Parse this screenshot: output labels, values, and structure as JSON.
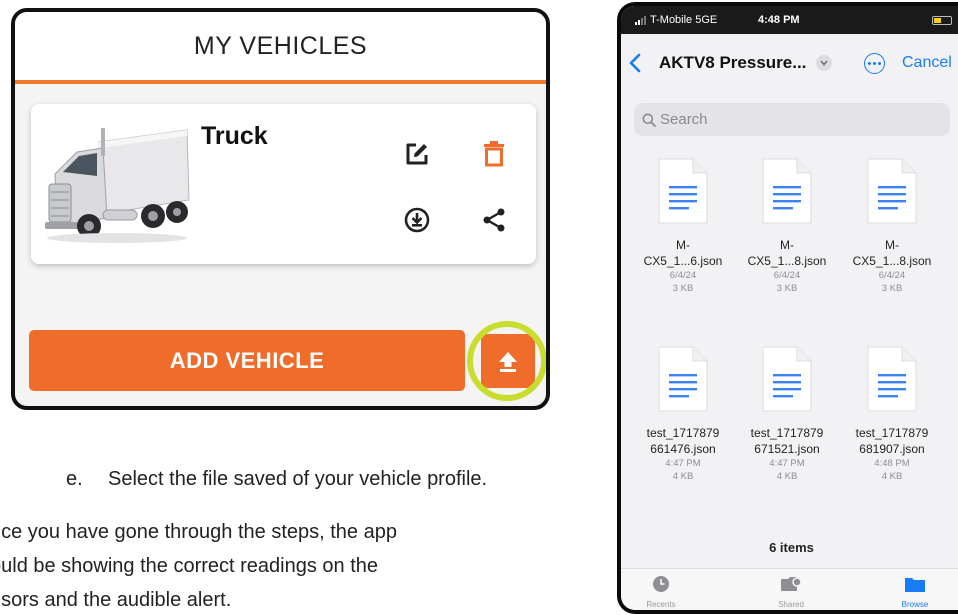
{
  "app": {
    "title": "MY VEHICLES",
    "vehicle": {
      "name": "Truck"
    },
    "add_vehicle_label": "ADD VEHICLE",
    "icons": [
      "edit-icon",
      "delete-icon",
      "download-icon",
      "share-icon",
      "upload-icon"
    ],
    "colors": {
      "accent": "#ef6c2a",
      "highlight": "#c9dd2f"
    }
  },
  "instructions": {
    "step_marker": "e.",
    "step_text": "Select the file saved of your vehicle profile.",
    "lines": [
      "nce you have gone through the steps, the app",
      "ould be showing the correct readings on the",
      "nsors and the audible alert."
    ]
  },
  "phone": {
    "status": {
      "carrier": "T-Mobile 5GE",
      "time": "4:48 PM"
    },
    "nav": {
      "title": "AKTV8  Pressure...",
      "cancel": "Cancel"
    },
    "search": {
      "placeholder": "Search"
    },
    "files": [
      {
        "name_line1": "M-",
        "name_line2": "CX5_1...6.json",
        "date": "6/4/24",
        "size": "3 KB"
      },
      {
        "name_line1": "M-",
        "name_line2": "CX5_1...8.json",
        "date": "6/4/24",
        "size": "3 KB"
      },
      {
        "name_line1": "M-",
        "name_line2": "CX5_1...8.json",
        "date": "6/4/24",
        "size": "3 KB"
      },
      {
        "name_line1": "test_1717879",
        "name_line2": "661476.json",
        "date": "4:47 PM",
        "size": "4 KB"
      },
      {
        "name_line1": "test_1717879",
        "name_line2": "671521.json",
        "date": "4:47 PM",
        "size": "4 KB"
      },
      {
        "name_line1": "test_1717879",
        "name_line2": "681907.json",
        "date": "4:48 PM",
        "size": "4 KB"
      }
    ],
    "items_count": "6 items",
    "tabs": [
      {
        "label": "Recents",
        "active": false
      },
      {
        "label": "Shared",
        "active": false
      },
      {
        "label": "Browse",
        "active": true
      }
    ],
    "colors": {
      "accent": "#1a7cf5",
      "doc_lines": "#3b82f6"
    }
  }
}
